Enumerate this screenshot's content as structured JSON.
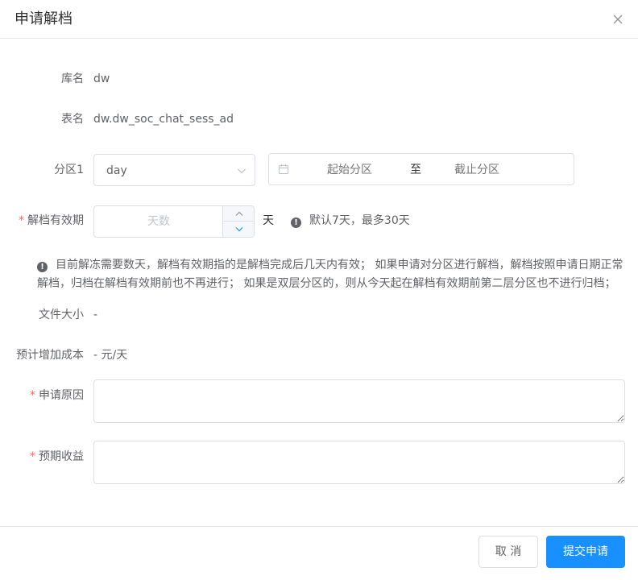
{
  "dialog": {
    "title": "申请解档"
  },
  "form": {
    "db_name": {
      "label": "库名",
      "value": "dw"
    },
    "table_name": {
      "label": "表名",
      "value": "dw.dw_soc_chat_sess_ad"
    },
    "partition": {
      "label": "分区1",
      "selected": "day",
      "range_start_placeholder": "起始分区",
      "range_separator": "至",
      "range_end_placeholder": "截止分区"
    },
    "validity": {
      "required_mark": "*",
      "label": "解档有效期",
      "placeholder": "天数",
      "unit": "天",
      "hint": "默认7天，最多30天"
    },
    "notice": "目前解冻需要数天，解档有效期指的是解档完成后几天内有效； 如果申请对分区进行解档，解档按照申请日期正常解档，归档在解档有效期前也不再进行； 如果是双层分区的，则从今天起在解档有效期前第二层分区也不进行归档；",
    "file_size": {
      "label": "文件大小",
      "value": "-"
    },
    "estimated_cost": {
      "label": "预计增加成本",
      "value": "- 元/天"
    },
    "reason": {
      "required_mark": "*",
      "label": "申请原因",
      "value": ""
    },
    "expected_benefit": {
      "required_mark": "*",
      "label": "预期收益",
      "value": ""
    }
  },
  "footer": {
    "cancel_label": "取 消",
    "submit_label": "提交申请"
  },
  "colors": {
    "primary": "#1890ff",
    "required": "#f56c6c",
    "border": "#dcdfe6"
  },
  "icons": {
    "close": "close-icon",
    "dropdown": "chevron-down-icon",
    "calendar": "calendar-icon",
    "increase": "chevron-up-icon",
    "decrease": "chevron-down-icon",
    "info": "info-circle-icon"
  }
}
